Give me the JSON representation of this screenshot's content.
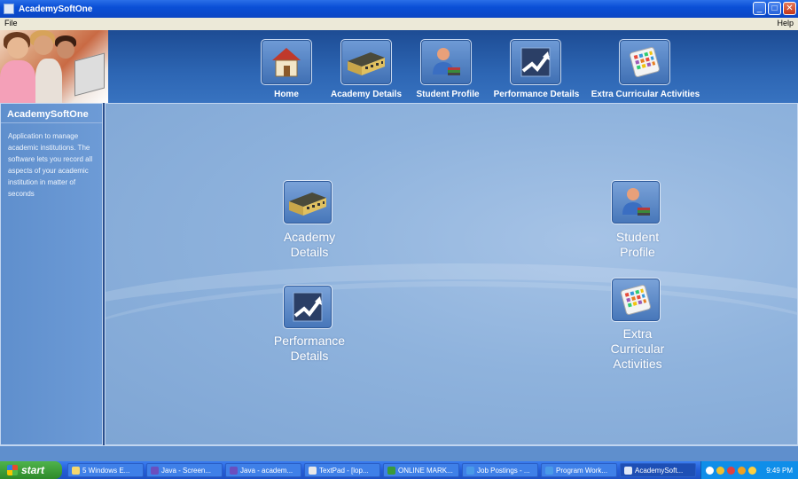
{
  "window": {
    "title": "AcademySoftOne"
  },
  "menu": {
    "file": "File",
    "help": "Help"
  },
  "nav": [
    {
      "label": "Home",
      "icon": "house-icon"
    },
    {
      "label": "Academy Details",
      "icon": "building-icon"
    },
    {
      "label": "Student Profile",
      "icon": "student-icon"
    },
    {
      "label": "Performance Details",
      "icon": "chart-icon"
    },
    {
      "label": "Extra Curricular Activities",
      "icon": "calculator-icon"
    }
  ],
  "sidebar": {
    "title": "AcademySoftOne",
    "description": "Application to manage academic institutions. The software lets you record all aspects of your academic institution in matter of seconds"
  },
  "main": {
    "academy": "Academy\nDetails",
    "student": "Student\nProfile",
    "performance": "Performance\nDetails",
    "extra": "Extra\nCurricular\nActivities"
  },
  "taskbar": {
    "start": "start",
    "tasks": [
      "5 Windows E...",
      "Java - Screen...",
      "Java - academ...",
      "TextPad - [lop...",
      "ONLINE MARK...",
      "Job Postings - ...",
      "Program Work...",
      "AcademySoft..."
    ],
    "clock": "9:49 PM"
  }
}
